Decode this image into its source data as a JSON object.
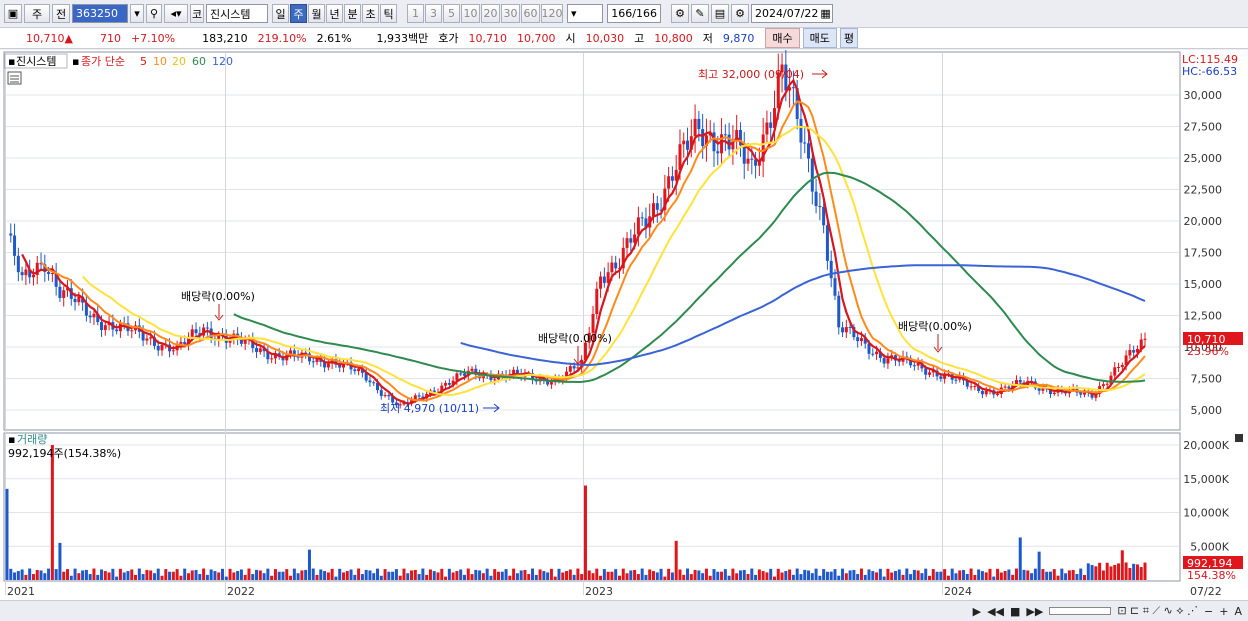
{
  "toolbar": {
    "market_type": "주",
    "market_prefix": "전",
    "stock_code": "363250",
    "code_prefix": "코",
    "stock_name": "진시스템",
    "periods": [
      "일",
      "주",
      "월",
      "년",
      "분",
      "초",
      "틱"
    ],
    "active_period": "주",
    "intervals": [
      "1",
      "3",
      "5",
      "10",
      "20",
      "30",
      "60",
      "120"
    ],
    "count": "166",
    "total": "/166",
    "date": "2024/07/22"
  },
  "quote": {
    "price": "10,710",
    "arrow": "▲",
    "change": "710",
    "change_pct": "+7.10%",
    "volume": "183,210",
    "volume_ratio": "219.10%",
    "turnover": "2.61%",
    "amount": "1,933백만",
    "bid_label": "호가",
    "ask_price": "10,710",
    "bid_price": "10,700",
    "open_label": "시",
    "open": "10,030",
    "high_label": "고",
    "high": "10,800",
    "low_label": "저",
    "low": "9,870",
    "buy_label": "매수",
    "sell_label": "매도",
    "eval_label": "평"
  },
  "chart": {
    "legend": {
      "name": "진시스템",
      "ma_label": "종가 단순",
      "ma_periods": [
        {
          "label": "5",
          "color": "#d8171d"
        },
        {
          "label": "10",
          "color": "#ff8a1c"
        },
        {
          "label": "20",
          "color": "#ffe23c"
        },
        {
          "label": "60",
          "color": "#2e8a4e"
        },
        {
          "label": "120",
          "color": "#3a63d6"
        }
      ]
    },
    "lc": "LC:115.49",
    "hc": "HC:-66.53",
    "price_axis": [
      "30,000",
      "27,500",
      "25,000",
      "22,500",
      "20,000",
      "17,500",
      "15,000",
      "12,500",
      "10,000",
      "7,500",
      "5,000"
    ],
    "current_price_tag": "10,710",
    "current_pct_tag": "23.96%",
    "annotations": {
      "high": "최고 32,000 (09/04)",
      "low": "최저 4,970 (10/11)",
      "dividend": "배당락(0.00%)"
    },
    "volume_title": "거래량",
    "volume_info": "992,194주(154.38%)",
    "volume_axis": [
      "20,000K",
      "15,000K",
      "10,000K",
      "5,000K"
    ],
    "volume_tag": "992,194",
    "volume_pct_tag": "154.38%",
    "time_axis": [
      "2021",
      "2022",
      "2023",
      "2024",
      "07/22"
    ],
    "colors": {
      "up": "#e0161d",
      "down": "#1f58c8"
    }
  },
  "statusbar": {
    "items": [
      "▶",
      "◀◀",
      "■",
      "▶▶",
      "−",
      "+",
      "A"
    ]
  }
}
